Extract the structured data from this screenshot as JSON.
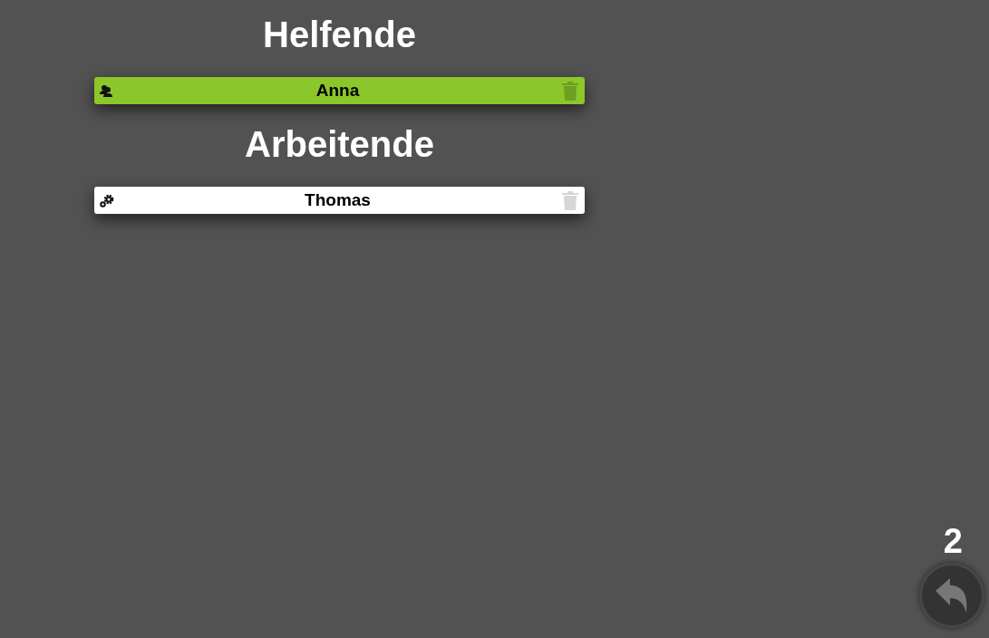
{
  "sections": [
    {
      "title": "Helfende",
      "people": [
        {
          "name": "Anna",
          "kind": "helper"
        }
      ]
    },
    {
      "title": "Arbeitende",
      "people": [
        {
          "name": "Thomas",
          "kind": "worker"
        }
      ]
    }
  ],
  "counter": "2"
}
